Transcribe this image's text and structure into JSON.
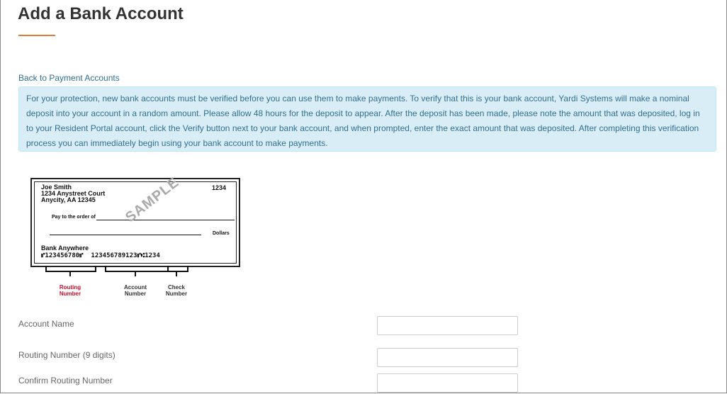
{
  "page": {
    "title": "Add a Bank Account",
    "back_link": "Back to Payment Accounts",
    "info_text": "For your protection, new bank accounts must be verified before you can use them to make payments. To verify that this is your bank account, Yardi Systems will make a nominal deposit into your account in a random amount. Please allow 48 hours for the deposit to appear. After the deposit has been made, please note the amount that was deposited, log in to your Resident Portal account, click the Verify button next to your bank account, and when prompted, enter the exact amount that was deposited. After completing this verification process you can immediately begin using your bank account to make payments."
  },
  "check_image": {
    "name_line1": "Joe Smith",
    "name_line2": "1234 Anystreet Court",
    "name_line3": "Anycity, AA 12345",
    "check_number": "1234",
    "pay_to": "Pay to the order of",
    "dollars": "Dollars",
    "bank": "Bank Anywhere",
    "micr": "⑈123456780⑈  123456789123⑈⑆1234",
    "sample": "SAMPLE",
    "label_routing_1": "Routing",
    "label_routing_2": "Number",
    "label_account_1": "Account",
    "label_account_2": "Number",
    "label_check_1": "Check",
    "label_check_2": "Number"
  },
  "form": {
    "account_name_label": "Account Name",
    "account_name_value": "",
    "routing_label": "Routing Number (9 digits)",
    "routing_value": "",
    "confirm_routing_label": "Confirm Routing Number",
    "confirm_routing_value": ""
  },
  "colors": {
    "accent": "#e07b39",
    "info_bg": "#d9edf7",
    "info_text": "#31708f",
    "routing_label": "#c8102e"
  }
}
